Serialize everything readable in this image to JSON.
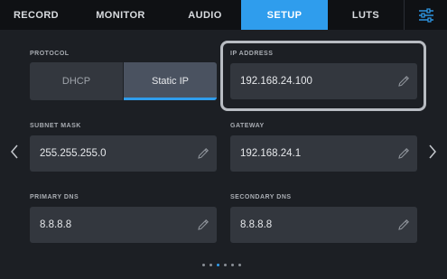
{
  "tabs": [
    {
      "label": "RECORD"
    },
    {
      "label": "MONITOR"
    },
    {
      "label": "AUDIO"
    },
    {
      "label": "SETUP",
      "active": true
    },
    {
      "label": "LUTS"
    }
  ],
  "menu_icon": "sliders-icon",
  "protocol": {
    "label": "PROTOCOL",
    "options": [
      "DHCP",
      "Static IP"
    ],
    "selected": "Static IP"
  },
  "ip_address": {
    "label": "IP ADDRESS",
    "value": "192.168.24.100"
  },
  "subnet_mask": {
    "label": "SUBNET MASK",
    "value": "255.255.255.0"
  },
  "gateway": {
    "label": "GATEWAY",
    "value": "192.168.24.1"
  },
  "primary_dns": {
    "label": "PRIMARY DNS",
    "value": "8.8.8.8"
  },
  "secondary_dns": {
    "label": "SECONDARY DNS",
    "value": "8.8.8.8"
  },
  "pagination": {
    "total": 6,
    "current": 3
  },
  "colors": {
    "accent": "#2f9ded",
    "background": "#1c1f24",
    "field": "#33373e",
    "tabbar": "#0f1114"
  }
}
